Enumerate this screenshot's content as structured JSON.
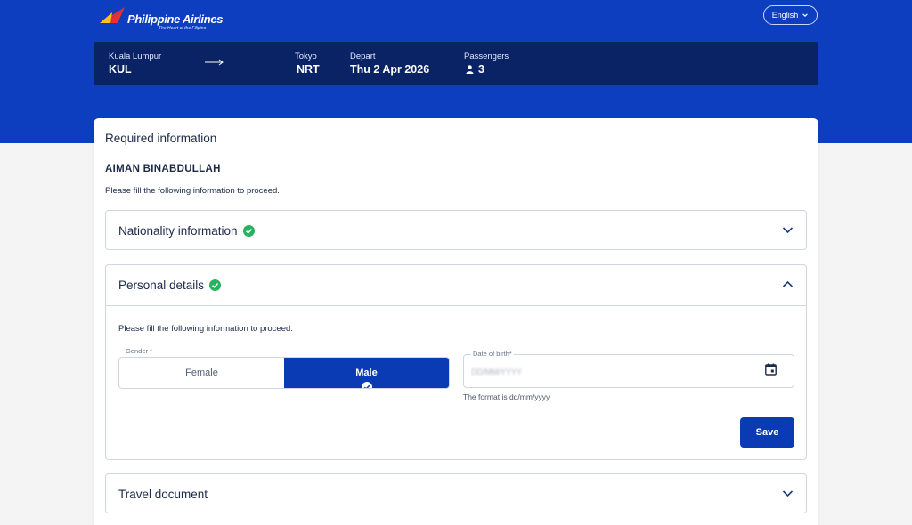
{
  "header": {
    "brand_name": "Philippine Airlines",
    "brand_tagline": "The Heart of the Filipino",
    "language_label": "English"
  },
  "flight": {
    "origin_city": "Kuala Lumpur",
    "origin_code": "KUL",
    "destination_city": "Tokyo",
    "destination_code": "NRT",
    "depart_label": "Depart",
    "depart_date": "Thu 2 Apr 2026",
    "passengers_label": "Passengers",
    "passengers_count": "3"
  },
  "form": {
    "title": "Required information",
    "passenger_name": "AIMAN BINABDULLAH",
    "intro": "Please fill the following information to proceed.",
    "sections": {
      "nationality": {
        "title": "Nationality information",
        "complete": true,
        "expanded": false
      },
      "personal": {
        "title": "Personal details",
        "complete": true,
        "expanded": true,
        "intro": "Please fill the following information to proceed.",
        "gender_label": "Gender *",
        "gender_options": [
          "Female",
          "Male"
        ],
        "gender_selected": "Male",
        "dob_label": "Date of birth*",
        "dob_placeholder": "DD/MM/YYYY",
        "dob_value": "",
        "dob_hint": "The format is dd/mm/yyyy",
        "save_label": "Save"
      },
      "travel_document": {
        "title": "Travel document",
        "complete": false,
        "expanded": false
      }
    }
  },
  "colors": {
    "brand_blue": "#0d3ebf",
    "navy": "#0a2364",
    "accent": "#0a3ab4",
    "success": "#27b25f",
    "page_bg": "#f4f4f4"
  }
}
